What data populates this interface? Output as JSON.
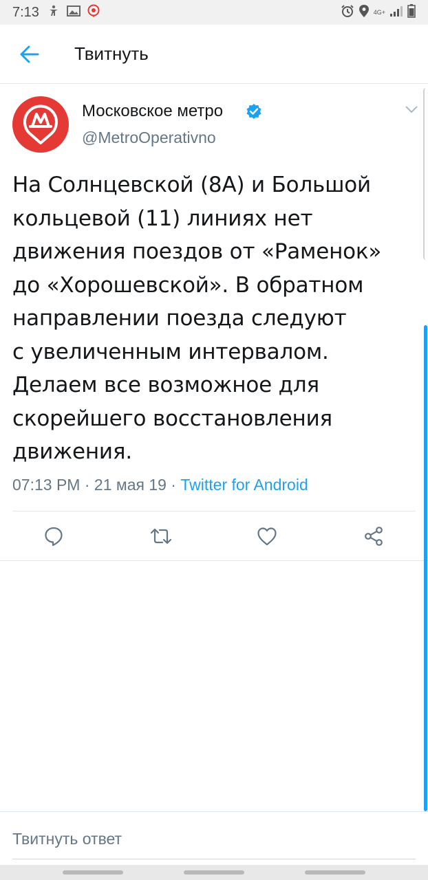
{
  "status_bar": {
    "time": "7:13",
    "network": "4G+",
    "icons": [
      "accessibility-icon",
      "image-icon",
      "shield-app-icon",
      "alarm-icon",
      "location-icon",
      "signal-icon",
      "battery-icon"
    ]
  },
  "app_bar": {
    "title": "Твитнуть",
    "back_icon": "arrow-left-icon"
  },
  "tweet": {
    "author_name": "Московское метро",
    "author_handle": "@MetroOperativno",
    "verified": true,
    "text_lines": [
      "На Солнцевской (8А) и Большой",
      "кольцевой (11) линиях нет",
      "движения поездов от «Раменок»",
      "до «Хорошевской». В обратном",
      "направлении поезда следуют",
      "с увеличенным интервалом.",
      "Делаем все возможное для",
      "скорейшего восстановления",
      "движения."
    ],
    "time": "07:13 PM",
    "date": "21 мая 19",
    "separator": " · ",
    "source": "Twitter for Android"
  },
  "actions": [
    "reply-icon",
    "retweet-icon",
    "like-icon",
    "share-icon"
  ],
  "reply": {
    "placeholder": "Твитнуть ответ"
  },
  "colors": {
    "accent": "#1da1f2",
    "brand_red": "#e53935",
    "secondary_text": "#657786",
    "primary_text": "#14171a"
  }
}
